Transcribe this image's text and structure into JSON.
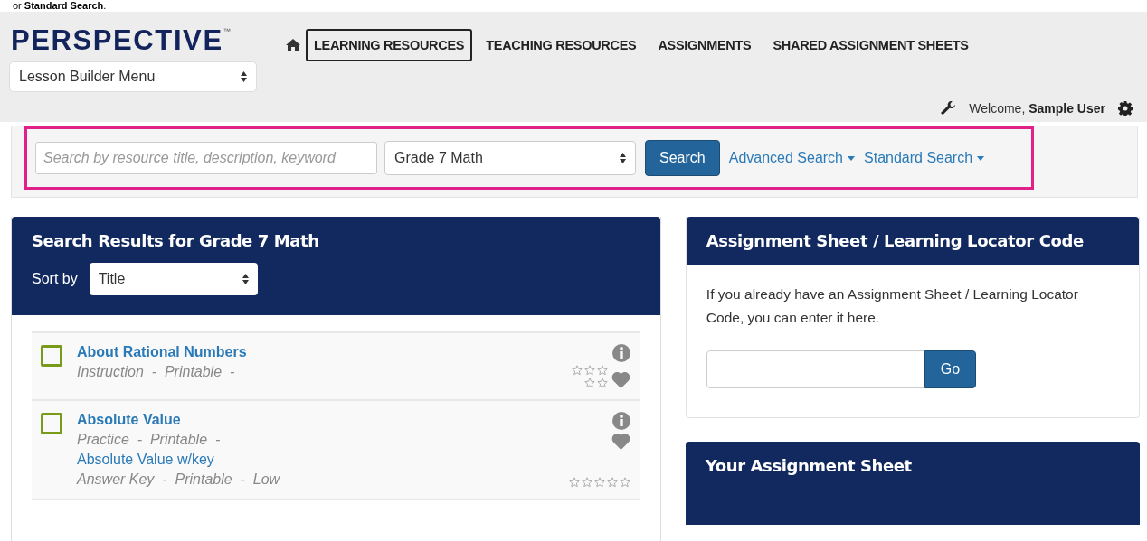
{
  "caption": "or **Standard Search**.",
  "header": {
    "logo": "PERSPECTIVE",
    "trademark": "™",
    "lesson_menu": "Lesson Builder Menu",
    "nav": [
      {
        "label": "LEARNING RESOURCES",
        "selected": true
      },
      {
        "label": "TEACHING RESOURCES",
        "selected": false
      },
      {
        "label": "ASSIGNMENTS",
        "selected": false
      },
      {
        "label": "SHARED ASSIGNMENT SHEETS",
        "selected": false
      }
    ],
    "welcome": "Welcome, **Sample User**"
  },
  "search": {
    "placeholder": "Search by resource title, description, keyword",
    "grade": "Grade 7 Math",
    "button": "Search",
    "links": [
      "Advanced Search",
      "Standard Search"
    ]
  },
  "results": {
    "title": "Search Results for Grade 7 Math",
    "sort_label": "Sort by",
    "sort_value": "Title",
    "items": [
      {
        "checked": false,
        "stars": 0,
        "resources": [
          {
            "title": "About Rational Numbers",
            "meta": "Instruction  -  Printable  -"
          }
        ]
      },
      {
        "checked": false,
        "stars": 0,
        "resources": [
          {
            "title": "Absolute Value",
            "meta": "Practice  -  Printable  -"
          },
          {
            "title": "Absolute Value w/key",
            "meta": "Answer Key  -  Printable  -  Low"
          }
        ]
      }
    ]
  },
  "locator": {
    "title": "Assignment Sheet / Learning Locator Code",
    "text": "If you already have an Assignment Sheet / Learning Locator Code, you can enter it here.",
    "button": "Go"
  },
  "assignment_sheet": {
    "title": "Your Assignment Sheet"
  }
}
